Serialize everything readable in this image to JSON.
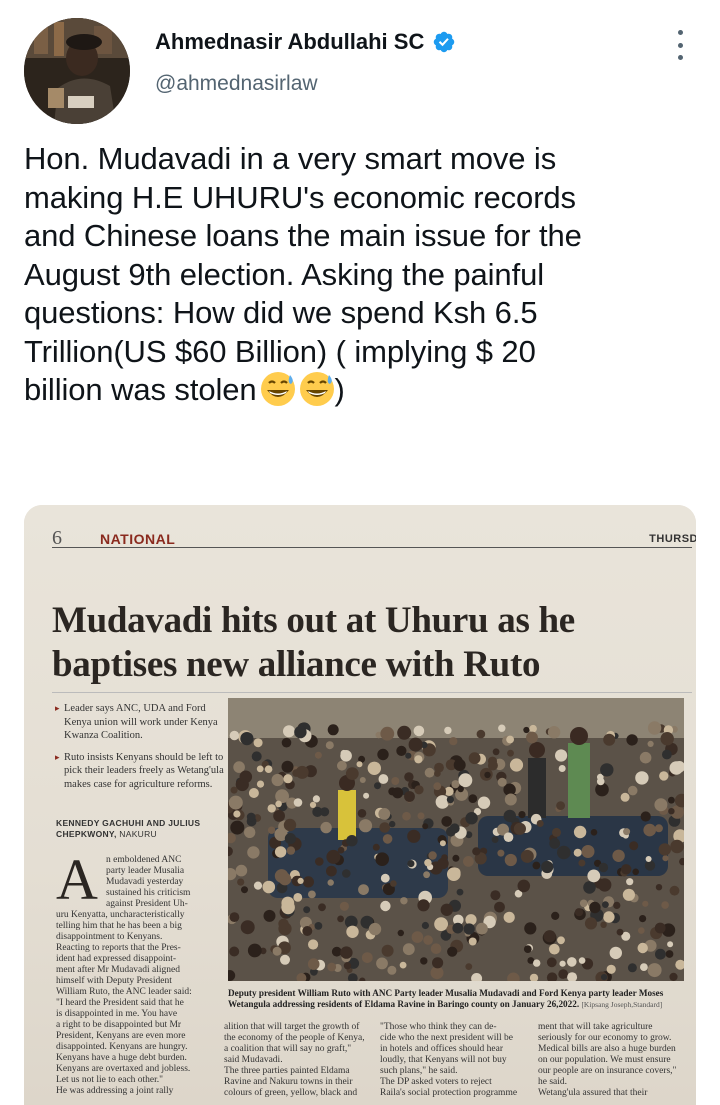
{
  "tweet": {
    "author_name": "Ahmednasir Abdullahi SC",
    "handle": "@ahmednasirlaw",
    "text_lines": [
      "Hon. Mudavadi in a very smart move is",
      "making H.E UHURU's economic records",
      "and Chinese loans the main issue for the",
      "August 9th election. Asking the painful",
      "questions: How did we spend Ksh 6.5",
      "Trillion(US $60 Billion) ( implying $ 20",
      "billion was stolen"
    ],
    "text_suffix": ")",
    "emoji": [
      "grinning-face-with-sweat",
      "grinning-face-with-sweat"
    ],
    "verified_color": "#1d9bf0"
  },
  "newspaper": {
    "page_number": "6",
    "section": "NATIONAL",
    "day": "THURSD",
    "headline_lines": [
      "Mudavadi hits out at Uhuru as he",
      "baptises new alliance with Ruto"
    ],
    "bullets": [
      "Leader says ANC, UDA and Ford Kenya union will work under Kenya Kwanza Coalition.",
      "Ruto insists Kenyans should be left to pick their leaders freely as Wetang'ula makes case for agriculture reforms."
    ],
    "byline": "KENNEDY GACHUHI AND JULIUS CHEPKWONY,",
    "byline_place": "NAKURU",
    "dropcap": "A",
    "lead_col_lines": [
      "n emboldened ANC",
      "party leader Musalia",
      "Mudavadi yesterday",
      "sustained his criticism",
      "against President Uh-"
    ],
    "col1_lines": [
      "uru Kenyatta, uncharacteristically",
      "telling him that he has been a big",
      "disappointment to Kenyans.",
      "   Reacting to reports that the Pres-",
      "ident had expressed disappoint-",
      "ment after Mr Mudavadi aligned",
      "himself with Deputy President",
      "William Ruto, the ANC leader said:",
      "\"I heard the President said that he",
      "is disappointed in me. You have",
      "a right to be disappointed but Mr",
      "President, Kenyans are even more",
      "disappointed. Kenyans are hungry.",
      "Kenyans have a huge debt burden.",
      "Kenyans are overtaxed and jobless.",
      "Let us not lie to each other.\"",
      "   He was addressing a joint rally"
    ],
    "caption": "Deputy president William Ruto with ANC Party leader Musalia Mudavadi and Ford Kenya party leader Moses Wetangula addressing residents of Eldama Ravine in Baringo county on January 26,2022.",
    "caption_credit": "[Kipsang Joseph,Standard]",
    "col2_lines": [
      "alition that will target the growth of",
      "the economy of the people of Kenya,",
      "a coalition that will say no graft,\"",
      "said Mudavadi.",
      "   The three parties painted Eldama",
      "Ravine and Nakuru towns in their",
      "colours of green, yellow, black and"
    ],
    "col3_lines": [
      "   \"Those who think they can de-",
      "cide who the next president will be",
      "in hotels and offices should hear",
      "loudly, that Kenyans will not buy",
      "such plans,\" he said.",
      "   The DP asked voters to reject",
      "Raila's social protection programme"
    ],
    "col4_lines": [
      "ment that will take agriculture",
      "seriously for our economy to grow.",
      "Medical bills are also a huge burden",
      "on our population. We must ensure",
      "our people are on insurance covers,\"",
      "he said.",
      "   Wetang'ula assured that their"
    ]
  }
}
